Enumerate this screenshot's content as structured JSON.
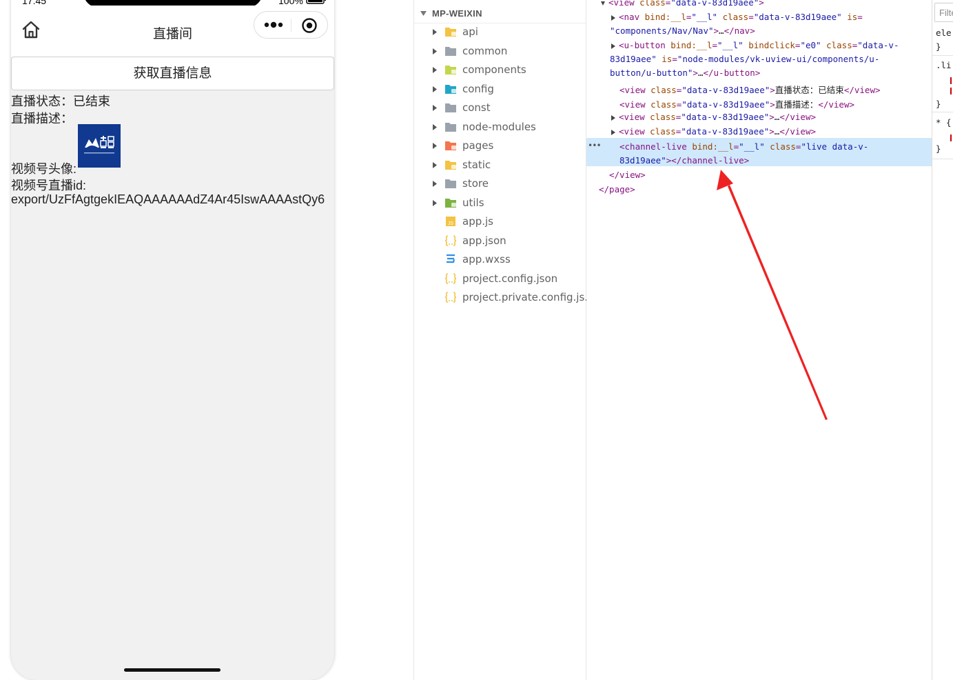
{
  "phone": {
    "status_time": "17:45",
    "battery_text": "100%",
    "nav_title": "直播间",
    "fetch_button_label": "获取直播信息",
    "live_status": "直播状态：已结束",
    "live_desc": "直播描述：",
    "avatar_label": "视频号头像:",
    "live_id_label": "视频号直播id:",
    "live_id_value": "export/UzFfAgtgekIEAQAAAAAAdZ4Ar45IswAAAAstQy6"
  },
  "explorer": {
    "title": "MP-WEIXIN",
    "items": [
      {
        "label": "api",
        "kind": "folder",
        "icon": "folder-api-icon",
        "color": "#f3c343"
      },
      {
        "label": "common",
        "kind": "folder",
        "icon": "folder-icon",
        "color": "#9aa3ad"
      },
      {
        "label": "components",
        "kind": "folder",
        "icon": "folder-components-icon",
        "color": "#c4d64d"
      },
      {
        "label": "config",
        "kind": "folder",
        "icon": "folder-config-icon",
        "color": "#22a6c8"
      },
      {
        "label": "const",
        "kind": "folder",
        "icon": "folder-icon",
        "color": "#9aa3ad"
      },
      {
        "label": "node-modules",
        "kind": "folder",
        "icon": "folder-icon",
        "color": "#9aa3ad"
      },
      {
        "label": "pages",
        "kind": "folder",
        "icon": "folder-pages-icon",
        "color": "#f2764e"
      },
      {
        "label": "static",
        "kind": "folder",
        "icon": "folder-static-icon",
        "color": "#f3c343"
      },
      {
        "label": "store",
        "kind": "folder",
        "icon": "folder-icon",
        "color": "#9aa3ad"
      },
      {
        "label": "utils",
        "kind": "folder",
        "icon": "folder-utils-icon",
        "color": "#7cb342"
      },
      {
        "label": "app.js",
        "kind": "file",
        "icon": "js-file-icon",
        "color": "#f3c343"
      },
      {
        "label": "app.json",
        "kind": "file",
        "icon": "json-file-icon",
        "color": "#f3c343"
      },
      {
        "label": "app.wxss",
        "kind": "file",
        "icon": "css-file-icon",
        "color": "#2f8fe6"
      },
      {
        "label": "project.config.json",
        "kind": "file",
        "icon": "json-file-icon",
        "color": "#f3c343"
      },
      {
        "label": "project.private.config.js...",
        "kind": "file",
        "icon": "json-file-icon",
        "color": "#f3c343"
      }
    ]
  },
  "inspector": {
    "lines": [
      [
        {
          "t": "tag",
          "v": "<view "
        },
        {
          "t": "attr",
          "v": "class"
        },
        {
          "t": "tag",
          "v": "="
        },
        {
          "t": "val",
          "v": "\"data-v-83d19aee\""
        },
        {
          "t": "tag",
          "v": ">"
        }
      ],
      [
        {
          "t": "tag",
          "v": "<nav "
        },
        {
          "t": "attr",
          "v": "bind:__l"
        },
        {
          "t": "tag",
          "v": "="
        },
        {
          "t": "val",
          "v": "\"__l\""
        },
        {
          "t": "tag",
          "v": " "
        },
        {
          "t": "attr",
          "v": "class"
        },
        {
          "t": "tag",
          "v": "="
        },
        {
          "t": "val",
          "v": "\"data-v-83d19aee\""
        },
        {
          "t": "tag",
          "v": " "
        },
        {
          "t": "attr",
          "v": "is"
        },
        {
          "t": "tag",
          "v": "="
        }
      ],
      [
        {
          "t": "val",
          "v": "\"components/Nav/Nav\""
        },
        {
          "t": "tag",
          "v": ">"
        },
        {
          "t": "txt",
          "v": "…"
        },
        {
          "t": "tag",
          "v": "</nav>"
        }
      ],
      [
        {
          "t": "tag",
          "v": "<u-button "
        },
        {
          "t": "attr",
          "v": "bind:__l"
        },
        {
          "t": "tag",
          "v": "="
        },
        {
          "t": "val",
          "v": "\"__l\""
        },
        {
          "t": "tag",
          "v": " "
        },
        {
          "t": "attr",
          "v": "bindclick"
        },
        {
          "t": "tag",
          "v": "="
        },
        {
          "t": "val",
          "v": "\"e0\""
        },
        {
          "t": "tag",
          "v": " "
        },
        {
          "t": "attr",
          "v": "class"
        },
        {
          "t": "tag",
          "v": "="
        },
        {
          "t": "val",
          "v": "\"data-v-"
        }
      ],
      [
        {
          "t": "val",
          "v": "83d19aee\""
        },
        {
          "t": "tag",
          "v": " "
        },
        {
          "t": "attr",
          "v": "is"
        },
        {
          "t": "tag",
          "v": "="
        },
        {
          "t": "val",
          "v": "\"node-modules/vk-uview-ui/components/u-"
        }
      ],
      [
        {
          "t": "val",
          "v": "button/u-button\""
        },
        {
          "t": "tag",
          "v": ">"
        },
        {
          "t": "txt",
          "v": "…"
        },
        {
          "t": "tag",
          "v": "</u-button>"
        }
      ],
      [
        {
          "t": "tag",
          "v": "<view "
        },
        {
          "t": "attr",
          "v": "class"
        },
        {
          "t": "tag",
          "v": "="
        },
        {
          "t": "val",
          "v": "\"data-v-83d19aee\""
        },
        {
          "t": "tag",
          "v": ">"
        },
        {
          "t": "txt",
          "v": "直播状态：已结束"
        },
        {
          "t": "tag",
          "v": "</view>"
        }
      ],
      [
        {
          "t": "tag",
          "v": "<view "
        },
        {
          "t": "attr",
          "v": "class"
        },
        {
          "t": "tag",
          "v": "="
        },
        {
          "t": "val",
          "v": "\"data-v-83d19aee\""
        },
        {
          "t": "tag",
          "v": ">"
        },
        {
          "t": "txt",
          "v": "直播描述："
        },
        {
          "t": "tag",
          "v": "</view>"
        }
      ],
      [
        {
          "t": "tag",
          "v": "<view "
        },
        {
          "t": "attr",
          "v": "class"
        },
        {
          "t": "tag",
          "v": "="
        },
        {
          "t": "val",
          "v": "\"data-v-83d19aee\""
        },
        {
          "t": "tag",
          "v": ">"
        },
        {
          "t": "txt",
          "v": "…"
        },
        {
          "t": "tag",
          "v": "</view>"
        }
      ],
      [
        {
          "t": "tag",
          "v": "<view "
        },
        {
          "t": "attr",
          "v": "class"
        },
        {
          "t": "tag",
          "v": "="
        },
        {
          "t": "val",
          "v": "\"data-v-83d19aee\""
        },
        {
          "t": "tag",
          "v": ">"
        },
        {
          "t": "txt",
          "v": "…"
        },
        {
          "t": "tag",
          "v": "</view>"
        }
      ],
      [
        {
          "t": "tag",
          "v": "<channel-live "
        },
        {
          "t": "attr",
          "v": "bind:__l"
        },
        {
          "t": "tag",
          "v": "="
        },
        {
          "t": "val",
          "v": "\"__l\""
        },
        {
          "t": "tag",
          "v": " "
        },
        {
          "t": "attr",
          "v": "class"
        },
        {
          "t": "tag",
          "v": "="
        },
        {
          "t": "val",
          "v": "\"live data-v-"
        }
      ],
      [
        {
          "t": "val",
          "v": "83d19aee\""
        },
        {
          "t": "tag",
          "v": "></channel-live>"
        }
      ],
      [
        {
          "t": "tag",
          "v": "</view>"
        }
      ],
      [
        {
          "t": "tag",
          "v": "</page>"
        }
      ]
    ],
    "selected_dots": "•••"
  },
  "styles": {
    "filter_placeholder": "Filter",
    "fragments": [
      "ele",
      "}",
      ".li",
      "}",
      "* {",
      "}"
    ]
  },
  "colors": {
    "annotation_arrow": "#ee2222",
    "selection": "#cfe8fc",
    "avatar_bg": "#10398f"
  }
}
